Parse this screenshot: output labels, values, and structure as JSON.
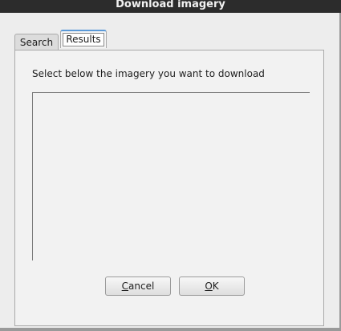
{
  "window": {
    "title": "Download imagery"
  },
  "tabs": [
    {
      "label": "Search",
      "selected": false
    },
    {
      "label": "Results",
      "selected": true
    }
  ],
  "results": {
    "instructions": "Select below the imagery you want to download",
    "items": []
  },
  "buttons": {
    "cancel": {
      "mnemonic": "C",
      "rest": "ancel"
    },
    "ok": {
      "mnemonic": "O",
      "rest": "K"
    }
  }
}
